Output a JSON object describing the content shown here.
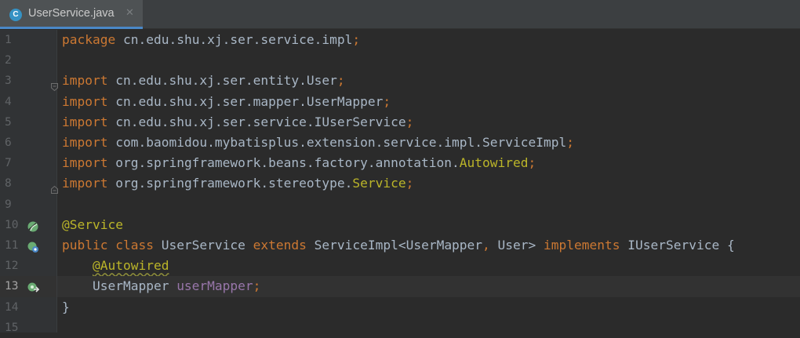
{
  "tab": {
    "file_name": "UserService.java",
    "file_icon_letter": "C",
    "close_glyph": "✕"
  },
  "editor": {
    "current_line": 13,
    "lines": [
      {
        "num": "1",
        "parts": [
          {
            "t": "package",
            "c": "kw"
          },
          {
            "t": " cn.edu.shu.xj.ser.service.impl",
            "c": "pl"
          },
          {
            "t": ";",
            "c": "kw"
          }
        ]
      },
      {
        "num": "2",
        "parts": []
      },
      {
        "num": "3",
        "parts": [
          {
            "t": "import",
            "c": "kw"
          },
          {
            "t": " cn.edu.shu.xj.ser.entity.User",
            "c": "pl"
          },
          {
            "t": ";",
            "c": "kw"
          }
        ],
        "fold": "open"
      },
      {
        "num": "4",
        "parts": [
          {
            "t": "import",
            "c": "kw"
          },
          {
            "t": " cn.edu.shu.xj.ser.mapper.UserMapper",
            "c": "pl"
          },
          {
            "t": ";",
            "c": "kw"
          }
        ]
      },
      {
        "num": "5",
        "parts": [
          {
            "t": "import",
            "c": "kw"
          },
          {
            "t": " cn.edu.shu.xj.ser.service.IUserService",
            "c": "pl"
          },
          {
            "t": ";",
            "c": "kw"
          }
        ]
      },
      {
        "num": "6",
        "parts": [
          {
            "t": "import",
            "c": "kw"
          },
          {
            "t": " com.baomidou.mybatisplus.extension.service.impl.ServiceImpl",
            "c": "pl"
          },
          {
            "t": ";",
            "c": "kw"
          }
        ]
      },
      {
        "num": "7",
        "parts": [
          {
            "t": "import",
            "c": "kw"
          },
          {
            "t": " org.springframework.beans.factory.annotation.",
            "c": "pl"
          },
          {
            "t": "Autowired",
            "c": "ann"
          },
          {
            "t": ";",
            "c": "kw"
          }
        ]
      },
      {
        "num": "8",
        "parts": [
          {
            "t": "import",
            "c": "kw"
          },
          {
            "t": " org.springframework.stereotype.",
            "c": "pl"
          },
          {
            "t": "Service",
            "c": "ann"
          },
          {
            "t": ";",
            "c": "kw"
          }
        ],
        "fold": "close"
      },
      {
        "num": "9",
        "parts": []
      },
      {
        "num": "10",
        "parts": [
          {
            "t": "@Service",
            "c": "ann"
          }
        ],
        "gutter_icon": "spring-bean-icon"
      },
      {
        "num": "11",
        "parts": [
          {
            "t": "public class",
            "c": "kw"
          },
          {
            "t": " UserService ",
            "c": "pl"
          },
          {
            "t": "extends",
            "c": "kw"
          },
          {
            "t": " ServiceImpl<UserMapper",
            "c": "pl"
          },
          {
            "t": ",",
            "c": "kw"
          },
          {
            "t": " User> ",
            "c": "pl"
          },
          {
            "t": "implements",
            "c": "kw"
          },
          {
            "t": " IUserService {",
            "c": "pl"
          }
        ],
        "gutter_icon": "implements-icon"
      },
      {
        "num": "12",
        "parts": [
          {
            "t": "    ",
            "c": "pl"
          },
          {
            "t": "@Autowired",
            "c": "ann squig"
          }
        ]
      },
      {
        "num": "13",
        "parts": [
          {
            "t": "    UserMapper ",
            "c": "pl"
          },
          {
            "t": "userMapper",
            "c": "fld"
          },
          {
            "t": ";",
            "c": "kw"
          }
        ],
        "gutter_icon": "autowired-navigate-icon"
      },
      {
        "num": "14",
        "parts": [
          {
            "t": "}",
            "c": "pl"
          }
        ]
      },
      {
        "num": "15",
        "parts": []
      }
    ]
  },
  "colors": {
    "keyword": "#cc7832",
    "plain": "#a9b7c6",
    "annotation": "#bbb529",
    "field": "#9876aa",
    "background": "#2b2b2b"
  }
}
